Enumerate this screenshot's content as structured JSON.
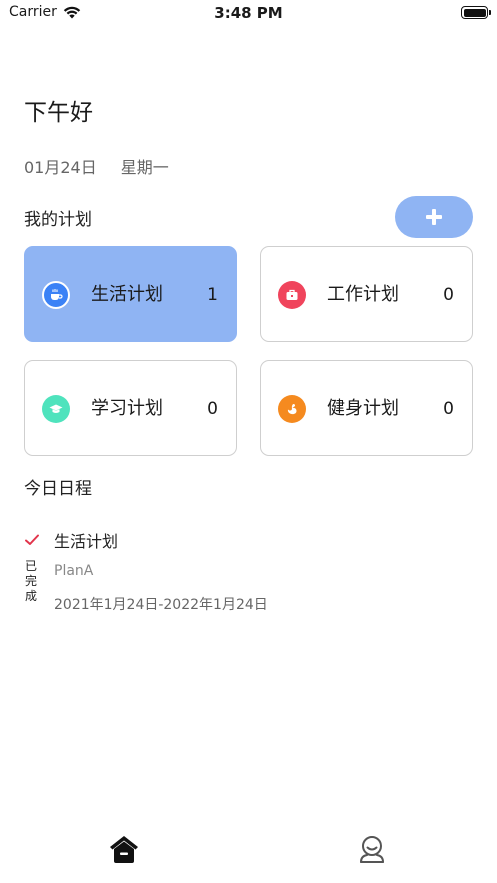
{
  "status_bar": {
    "carrier": "Carrier",
    "time": "3:48 PM"
  },
  "header": {
    "greeting": "下午好",
    "date": "01月24日",
    "weekday": "星期一"
  },
  "plans": {
    "title": "我的计划",
    "add_icon": "plus-icon",
    "cards": [
      {
        "label": "生活计划",
        "count": "1",
        "icon": "coffee-cup-icon",
        "color": "#3b82f6",
        "active": true
      },
      {
        "label": "工作计划",
        "count": "0",
        "icon": "briefcase-icon",
        "color": "#f0445c",
        "active": false
      },
      {
        "label": "学习计划",
        "count": "0",
        "icon": "graduation-cap-icon",
        "color": "#4fe3bd",
        "active": false
      },
      {
        "label": "健身计划",
        "count": "0",
        "icon": "fitness-icon",
        "color": "#f58a1f",
        "active": false
      }
    ]
  },
  "schedule": {
    "title": "今日日程",
    "items": [
      {
        "title": "生活计划",
        "status": "已完成",
        "plan": "PlanA",
        "range": "2021年1月24日-2022年1月24日",
        "check_color": "#e2344b"
      }
    ]
  },
  "tab_bar": {
    "tabs": [
      {
        "icon": "home-icon"
      },
      {
        "icon": "profile-icon"
      }
    ]
  },
  "colors": {
    "accent": "#8fb4f3",
    "card_border": "#cfcfcf"
  }
}
